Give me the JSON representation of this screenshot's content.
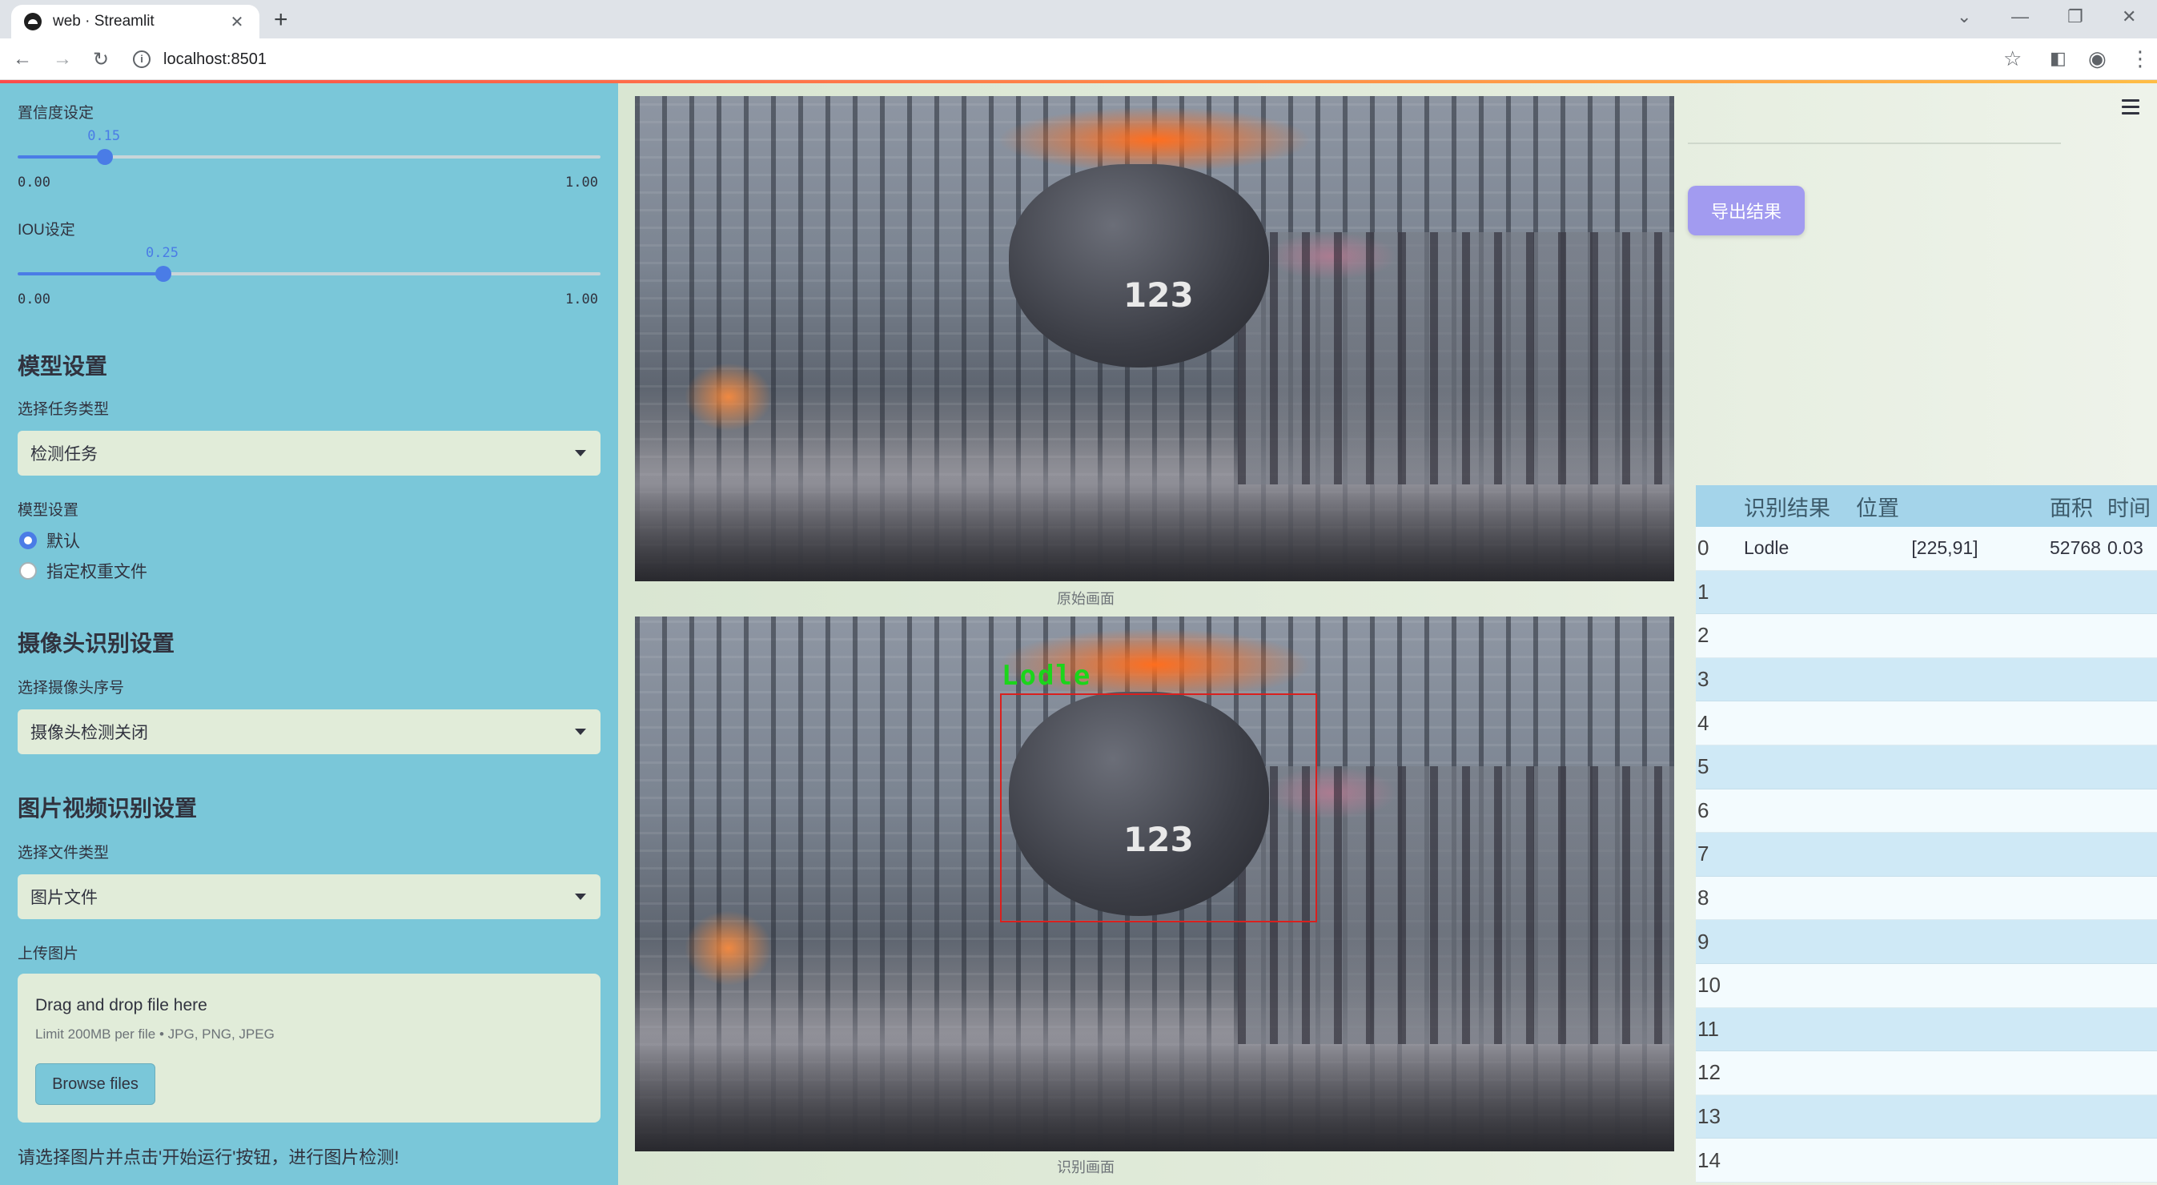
{
  "browser": {
    "tab_title": "web · Streamlit",
    "new_tab": "+",
    "url": "localhost:8501"
  },
  "sidebar": {
    "confidence": {
      "label": "置信度设定",
      "value": "0.15",
      "min": "0.00",
      "max": "1.00",
      "fraction": 0.15
    },
    "iou": {
      "label": "IOU设定",
      "value": "0.25",
      "min": "0.00",
      "max": "1.00",
      "fraction": 0.25
    },
    "model_section": {
      "title": "模型设置",
      "task_label": "选择任务类型",
      "task_value": "检测任务",
      "model_label": "模型设置",
      "options": [
        "默认",
        "指定权重文件"
      ],
      "selected": 0
    },
    "camera_section": {
      "title": "摄像头识别设置",
      "camera_label": "选择摄像头序号",
      "camera_value": "摄像头检测关闭"
    },
    "media_section": {
      "title": "图片视频识别设置",
      "file_type_label": "选择文件类型",
      "file_type_value": "图片文件",
      "upload_label": "上传图片",
      "drop_text": "Drag and drop file here",
      "limit_text": "Limit 200MB per file • JPG, PNG, JPEG",
      "browse_label": "Browse files"
    },
    "footer_text": "请选择图片并点击'开始运行'按钮，进行图片检测!"
  },
  "main": {
    "original_caption": "原始画面",
    "detected_caption": "识别画面",
    "ladle_number": "123",
    "detection_label": "Lodle",
    "export_label": "导出结果"
  },
  "table": {
    "headers": [
      "",
      "识别结果",
      "位置",
      "面积",
      "时间"
    ],
    "rows": [
      [
        "0",
        "Lodle",
        "[225,91]",
        "52768",
        "0.03"
      ],
      [
        "1",
        "",
        "",
        "",
        ""
      ],
      [
        "2",
        "",
        "",
        "",
        ""
      ],
      [
        "3",
        "",
        "",
        "",
        ""
      ],
      [
        "4",
        "",
        "",
        "",
        ""
      ],
      [
        "5",
        "",
        "",
        "",
        ""
      ],
      [
        "6",
        "",
        "",
        "",
        ""
      ],
      [
        "7",
        "",
        "",
        "",
        ""
      ],
      [
        "8",
        "",
        "",
        "",
        ""
      ],
      [
        "9",
        "",
        "",
        "",
        ""
      ],
      [
        "10",
        "",
        "",
        "",
        ""
      ],
      [
        "11",
        "",
        "",
        "",
        ""
      ],
      [
        "12",
        "",
        "",
        "",
        ""
      ],
      [
        "13",
        "",
        "",
        "",
        ""
      ],
      [
        "14",
        "",
        "",
        "",
        ""
      ]
    ]
  },
  "colors": {
    "sidebar_bg": "#7ac7d9",
    "slider_accent": "#4a7ce6",
    "export_button": "#a29bf0",
    "detection_box": "#d9201e",
    "detection_text": "#1bd51b",
    "table_header": "#a4d4ea"
  }
}
